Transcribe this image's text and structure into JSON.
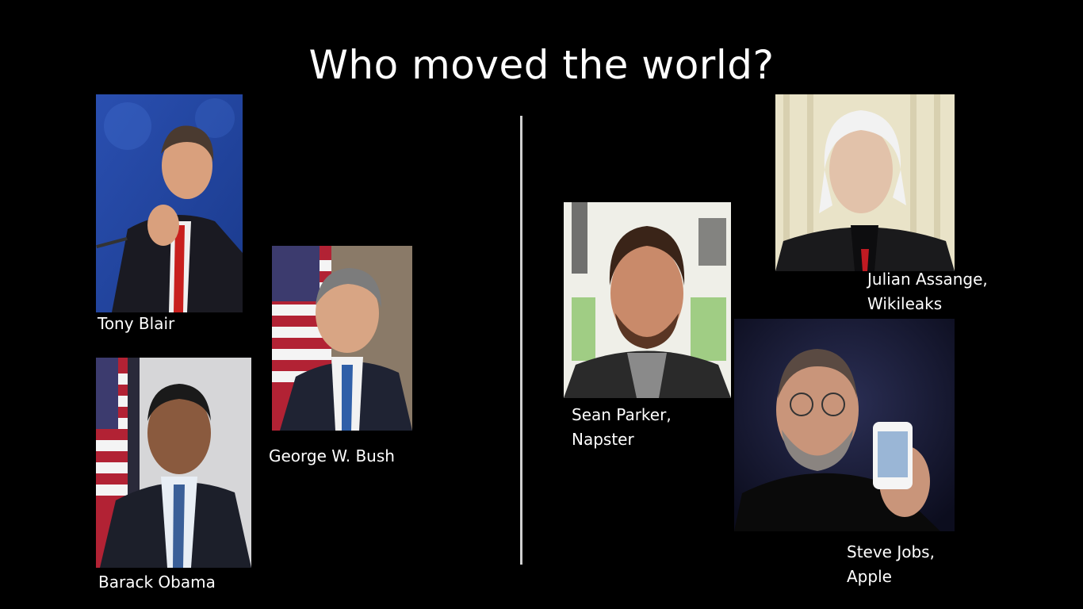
{
  "slide": {
    "title": "Who moved the world?"
  },
  "left_group": {
    "people": [
      {
        "name": "Tony Blair"
      },
      {
        "name": "George W. Bush"
      },
      {
        "name": "Barack Obama"
      }
    ]
  },
  "right_group": {
    "people": [
      {
        "name": "Julian Assange,",
        "affiliation": "Wikileaks"
      },
      {
        "name": "Sean Parker,",
        "affiliation": "Napster"
      },
      {
        "name": "Steve Jobs,",
        "affiliation": "Apple"
      }
    ]
  },
  "colors": {
    "background": "#000000",
    "text": "#ffffff",
    "divider": "#cfcfcf"
  }
}
